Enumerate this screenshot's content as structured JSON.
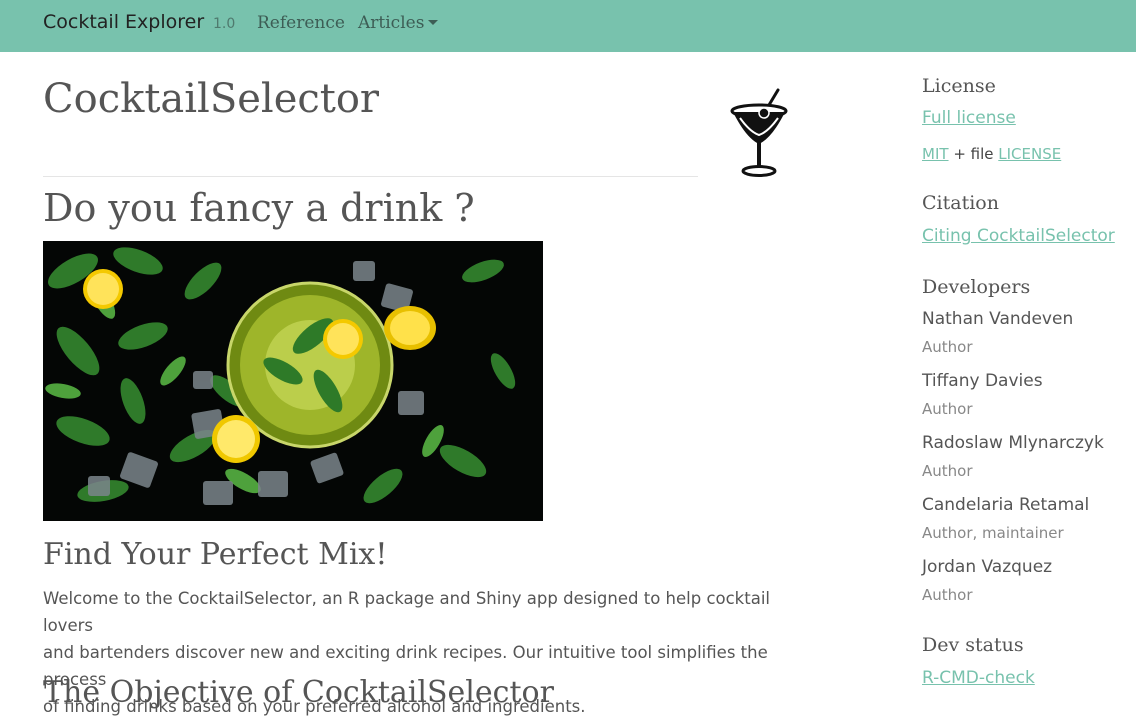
{
  "navbar": {
    "brand": "Cocktail Explorer",
    "version": "1.0",
    "links": [
      {
        "label": "Reference"
      },
      {
        "label": "Articles"
      }
    ]
  },
  "main": {
    "package_title": "CocktailSelector",
    "heading": "Do you fancy a drink ?",
    "subheading": "Find Your Perfect Mix!",
    "intro_lines": [
      "Welcome to the CocktailSelector, an R package and Shiny app designed to help cocktail lovers",
      "and bartenders discover new and exciting drink recipes. Our intuitive tool simplifies the process",
      "of finding drinks based on your preferred alcohol and ingredients."
    ],
    "next_heading": "The Objective of CocktailSelector"
  },
  "sidebar": {
    "license": {
      "title": "License",
      "full_license": "Full license",
      "mit": "MIT",
      "plus_file": "+ file",
      "license_file": "LICENSE"
    },
    "citation": {
      "title": "Citation",
      "link": "Citing CocktailSelector"
    },
    "developers": {
      "title": "Developers",
      "people": [
        {
          "name": "Nathan Vandeven",
          "role": "Author"
        },
        {
          "name": "Tiffany Davies",
          "role": "Author"
        },
        {
          "name": "Radoslaw Mlynarczyk",
          "role": "Author"
        },
        {
          "name": "Candelaria Retamal",
          "role": "Author, maintainer"
        },
        {
          "name": "Jordan Vazquez",
          "role": "Author"
        }
      ]
    },
    "dev_status": {
      "title": "Dev status",
      "badge": "R-CMD-check"
    }
  },
  "colors": {
    "accent": "#78c2ad",
    "text": "#555555"
  },
  "icons": [
    "martini-glass-icon",
    "caret-down-icon"
  ]
}
